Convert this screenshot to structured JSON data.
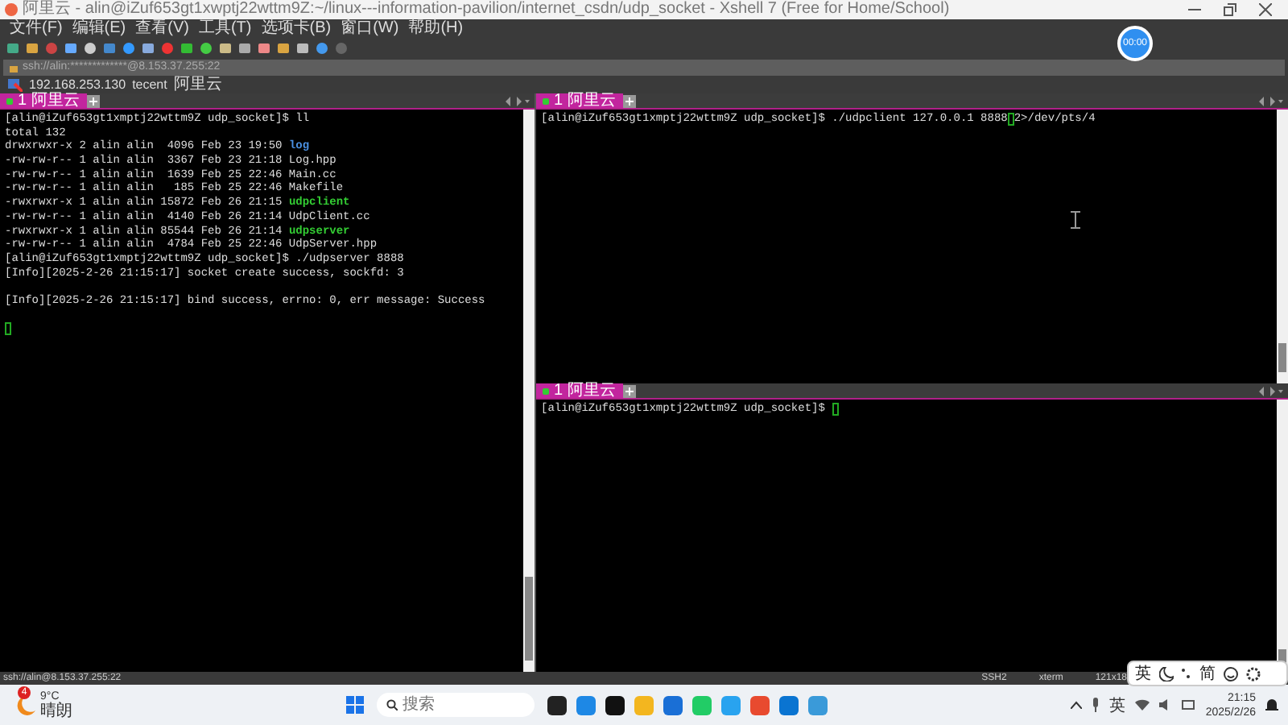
{
  "window": {
    "title": "阿里云 - alin@iZuf653gt1xwptj22wttm9Z:~/linux---information-pavilion/internet_csdn/udp_socket - Xshell 7 (Free for Home/School)"
  },
  "menu": [
    "文件(F)",
    "编辑(E)",
    "查看(V)",
    "工具(T)",
    "选项卡(B)",
    "窗口(W)",
    "帮助(H)"
  ],
  "address_bar": {
    "value": "ssh://alin:*************@8.153.37.255:22"
  },
  "session_bar": {
    "items": [
      "192.168.253.130",
      "tecent",
      "阿里云"
    ]
  },
  "timer_badge": "00:00",
  "panes": [
    {
      "tab": {
        "label": "1 阿里云",
        "selected": true
      },
      "lines": [
        [
          {
            "kind": "plain",
            "text": "[alin@iZuf653gt1xmptj22wttm9Z udp_socket]$ ll"
          }
        ],
        [
          {
            "kind": "plain",
            "text": "total 132"
          }
        ],
        [
          {
            "kind": "plain",
            "text": "drwxrwxr-x 2 alin alin  4096 Feb 23 19:50 "
          },
          {
            "kind": "dir",
            "text": "log"
          }
        ],
        [
          {
            "kind": "plain",
            "text": "-rw-rw-r-- 1 alin alin  3367 Feb 23 21:18 Log.hpp"
          }
        ],
        [
          {
            "kind": "plain",
            "text": "-rw-rw-r-- 1 alin alin  1639 Feb 25 22:46 Main.cc"
          }
        ],
        [
          {
            "kind": "plain",
            "text": "-rw-rw-r-- 1 alin alin   185 Feb 25 22:46 Makefile"
          }
        ],
        [
          {
            "kind": "plain",
            "text": "-rwxrwxr-x 1 alin alin 15872 Feb 26 21:15 "
          },
          {
            "kind": "exec",
            "text": "udpclient"
          }
        ],
        [
          {
            "kind": "plain",
            "text": "-rw-rw-r-- 1 alin alin  4140 Feb 26 21:14 UdpClient.cc"
          }
        ],
        [
          {
            "kind": "plain",
            "text": "-rwxrwxr-x 1 alin alin 85544 Feb 26 21:14 "
          },
          {
            "kind": "exec",
            "text": "udpserver"
          }
        ],
        [
          {
            "kind": "plain",
            "text": "-rw-rw-r-- 1 alin alin  4784 Feb 25 22:46 UdpServer.hpp"
          }
        ],
        [
          {
            "kind": "plain",
            "text": "[alin@iZuf653gt1xmptj22wttm9Z udp_socket]$ ./udpserver 8888"
          }
        ],
        [
          {
            "kind": "plain",
            "text": "[Info][2025-2-26 21:15:17] socket create success, sockfd: 3"
          }
        ],
        [
          {
            "kind": "blank"
          }
        ],
        [
          {
            "kind": "plain",
            "text": "[Info][2025-2-26 21:15:17] bind success, errno: 0, err message: Success"
          }
        ],
        [
          {
            "kind": "blank"
          }
        ],
        [
          {
            "kind": "cursor"
          }
        ]
      ]
    },
    {
      "tab": {
        "label": "1 阿里云",
        "selected": true
      },
      "lines": [
        [
          {
            "kind": "plain",
            "text": "[alin@iZuf653gt1xmptj22wttm9Z udp_socket]$ ./udpclient 127.0.0.1 8888"
          },
          {
            "kind": "cursor"
          },
          {
            "kind": "plain",
            "text": "2>/dev/pts/4"
          }
        ]
      ]
    },
    {
      "tab": {
        "label": "1 阿里云",
        "selected": true
      },
      "lines": [
        [
          {
            "kind": "plain",
            "text": "[alin@iZuf653gt1xmptj22wttm9Z udp_socket]$ "
          },
          {
            "kind": "cursor"
          }
        ]
      ]
    }
  ],
  "status_bar": {
    "address": "ssh://alin@8.153.37.255:22",
    "protocol": "SSH2",
    "terminal": "xterm",
    "size": "121x18"
  },
  "ime_bar": {
    "mode": "英",
    "script": "简"
  },
  "taskbar": {
    "weather": {
      "temperature": "9°C",
      "condition": "晴朗",
      "badge": "4"
    },
    "search": {
      "placeholder": "搜索"
    },
    "tray": {
      "language": "英",
      "time": "21:15",
      "date": "2025/2/26"
    }
  }
}
